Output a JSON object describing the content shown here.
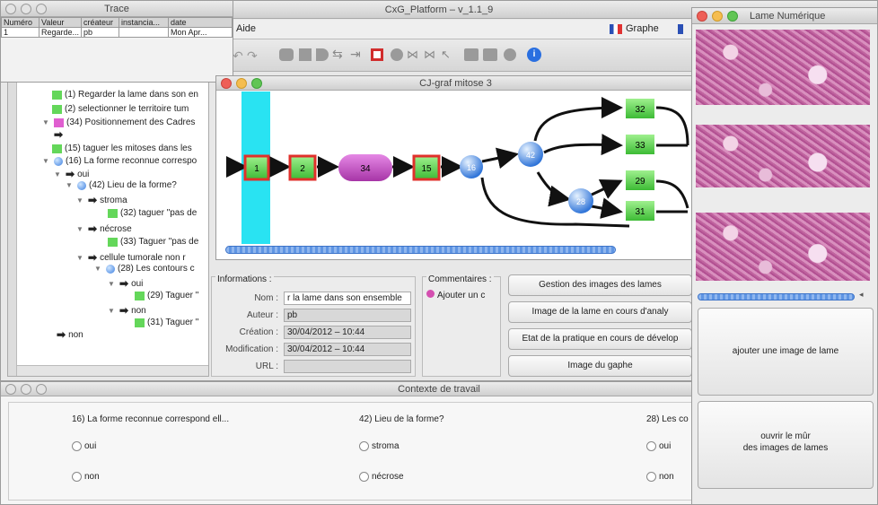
{
  "main_window": {
    "title": "CxG_Platform – v_1.1_9",
    "menu": {
      "aide": "Aide",
      "graphe": "Graphe"
    }
  },
  "trace_window": {
    "title": "Trace",
    "columns": [
      "Numéro",
      "Valeur",
      "créateur",
      "instancia...",
      "date"
    ],
    "rows": [
      [
        "1",
        "Regarde...",
        "pb",
        "",
        "Mon Apr..."
      ]
    ]
  },
  "tree": {
    "items": [
      {
        "text": "(1) Regarder la lame dans son en",
        "icon": "green"
      },
      {
        "text": "(2) selectionner le territoire tum",
        "icon": "green"
      },
      {
        "text": "(34) Positionnement des Cadres",
        "icon": "pink"
      },
      {
        "text": "",
        "icon": "arrow"
      },
      {
        "text": "(15) taguer les mitoses dans les",
        "icon": "green"
      },
      {
        "text": "(16) La forme reconnue correspo",
        "icon": "circle"
      },
      {
        "text": "oui",
        "icon": "arrow"
      },
      {
        "text": "(42) Lieu de la forme?",
        "icon": "circle"
      },
      {
        "text": "stroma",
        "icon": "arrow"
      },
      {
        "text": "(32) taguer \"pas de",
        "icon": "green"
      },
      {
        "text": "nécrose",
        "icon": "arrow"
      },
      {
        "text": "(33) Taguer \"pas de",
        "icon": "green"
      },
      {
        "text": "cellule tumorale non r",
        "icon": "arrow"
      },
      {
        "text": "(28) Les contours c",
        "icon": "circle"
      },
      {
        "text": "oui",
        "icon": "arrow"
      },
      {
        "text": "(29) Taguer \"",
        "icon": "green"
      },
      {
        "text": "non",
        "icon": "arrow"
      },
      {
        "text": "(31) Taguer \"",
        "icon": "green"
      },
      {
        "text": "non",
        "icon": "arrow"
      }
    ]
  },
  "graph_window": {
    "title": "CJ-graf mitose 3",
    "nodes": {
      "n1": "1",
      "n2": "2",
      "n34": "34",
      "n15": "15",
      "n16": "16",
      "n42": "42",
      "n28": "28",
      "n32": "32",
      "n33": "33",
      "n29": "29",
      "n31": "31"
    }
  },
  "informations": {
    "title": "Informations :",
    "nom_label": "Nom :",
    "nom_value": "r la lame dans son ensemble",
    "auteur_label": "Auteur :",
    "auteur_value": "pb",
    "creation_label": "Création :",
    "creation_value": "30/04/2012 – 10:44",
    "modification_label": "Modification :",
    "modification_value": "30/04/2012 – 10:44",
    "url_label": "URL :",
    "url_value": ""
  },
  "commentaires": {
    "title": "Commentaires :",
    "add_label": "Ajouter un c"
  },
  "action_buttons": [
    "Gestion des images des lames",
    "Image de la lame en cours d'analy",
    "Etat de la pratique en cours de dévelop",
    "Image du gaphe"
  ],
  "context_window": {
    "title": "Contexte de travail",
    "questions": [
      {
        "q": "16) La forme reconnue correspond ell...",
        "opts": [
          "oui",
          "non"
        ]
      },
      {
        "q": "42) Lieu de la forme?",
        "opts": [
          "stroma",
          "nécrose"
        ]
      },
      {
        "q": "28) Les co",
        "opts": [
          "oui",
          "non"
        ]
      }
    ]
  },
  "lame_window": {
    "title": "Lame Numérique",
    "add_button": "ajouter une image de lame",
    "open_button_line1": "ouvrir le mûr",
    "open_button_line2": "des images de lames"
  },
  "colors": {
    "accent_blue": "#3b7ee0",
    "node_green": "#64d75a",
    "node_red_border": "#e0302b",
    "pink_node": "#c14fc1",
    "cyan_column": "#29e3f2"
  }
}
